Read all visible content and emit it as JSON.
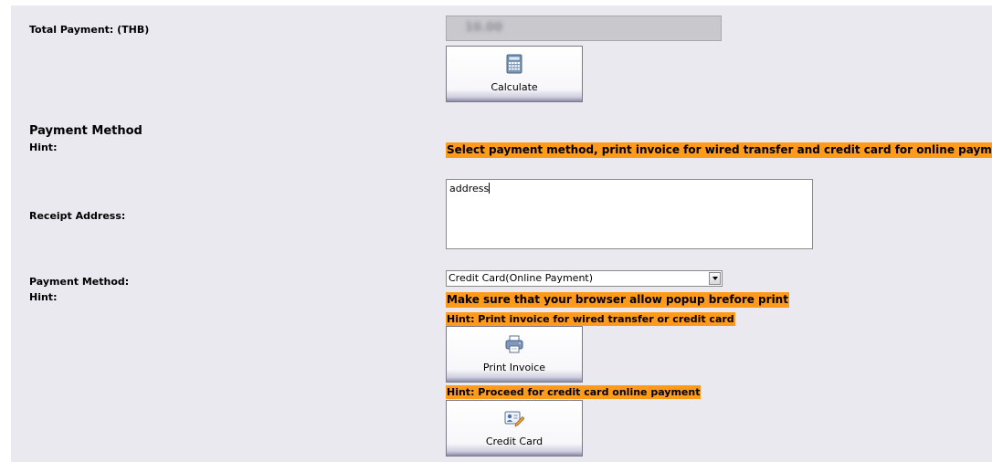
{
  "total": {
    "label": "Total Payment: (THB)",
    "value": "10.00",
    "calculate_label": "Calculate"
  },
  "payment_section": {
    "heading": "Payment Method",
    "hint_label": "Hint:",
    "hint_text": "Select payment method, print invoice for wired transfer and credit card for online payme"
  },
  "receipt": {
    "label": "Receipt Address:",
    "value": "address"
  },
  "method": {
    "label": "Payment Method:",
    "selected": "Credit Card(Online Payment)",
    "hint_label": "Hint:",
    "popup_hint": "Make sure that your browser allow popup brefore print",
    "print_hint": "Hint: Print invoice for wired transfer or credit card",
    "print_label": "Print Invoice",
    "card_hint": "Hint: Proceed for credit card online payment",
    "card_label": "Credit Card"
  },
  "colors": {
    "panel_bg": "#e9e9ef",
    "hint_highlight": "#ff9a1a",
    "readonly_field": "#c9c9cd"
  },
  "icons": {
    "calculate": "calculator-icon",
    "print": "printer-icon",
    "card": "id-card-pen-icon",
    "dropdown": "chevron-down-icon"
  }
}
